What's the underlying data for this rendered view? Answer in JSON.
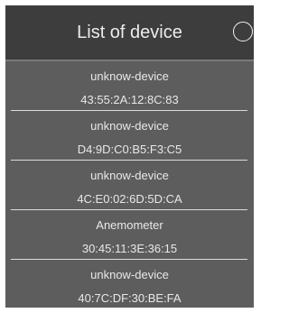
{
  "dialog": {
    "title": "List of device"
  },
  "devices": [
    {
      "name": "unknow-device",
      "mac": "43:55:2A:12:8C:83"
    },
    {
      "name": "unknow-device",
      "mac": "D4:9D:C0:B5:F3:C5"
    },
    {
      "name": "unknow-device",
      "mac": "4C:E0:02:6D:5D:CA"
    },
    {
      "name": "Anemometer",
      "mac": "30:45:11:3E:36:15"
    },
    {
      "name": "unknow-device",
      "mac": "40:7C:DF:30:BE:FA"
    }
  ],
  "icons": {
    "spinner": "loading-spinner-icon"
  },
  "colors": {
    "header_bg": "#3d3d3d",
    "list_bg": "#5d5d5d",
    "text": "#e8e8e8"
  }
}
